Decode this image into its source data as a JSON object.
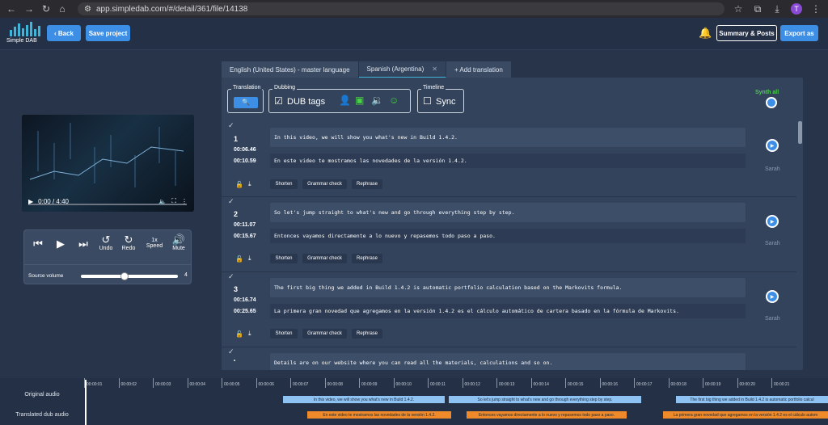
{
  "browser": {
    "url": "app.simpledab.com/#/detail/361/file/14138",
    "avatar_letter": "T"
  },
  "app": {
    "logo_text": "Simple DAB",
    "back": "Back",
    "save": "Save project",
    "summary": "Summary & Posts",
    "export": "Export as"
  },
  "video": {
    "time": "0:00 / 4:40"
  },
  "controls": {
    "undo": "Undo",
    "redo": "Redo",
    "speed_value": "1x",
    "speed": "Speed",
    "mute": "Mute",
    "volume_label": "Source volume",
    "volume_value": "4",
    "volume_fraction": 0.45
  },
  "tabs": [
    {
      "label": "English (United States) - master language"
    },
    {
      "label": "Spanish (Argentina)"
    },
    {
      "label": "+ Add translation"
    }
  ],
  "toolbar": {
    "translation": "Translation",
    "dubbing": "Dubbing",
    "dub_tags": "DUB tags",
    "timeline": "Timeline",
    "sync": "Sync",
    "synth_all": "Synth all"
  },
  "segments": [
    {
      "num": "1",
      "start": "00:06.46",
      "end": "00:10.59",
      "src": "In this video, we will show you what's new in Build 1.4.2.",
      "tgt": "En este video te mostramos las novedades de la versión 1.4.2.",
      "voice": "Sarah"
    },
    {
      "num": "2",
      "start": "00:11.07",
      "end": "00:15.67",
      "src": "So let's jump straight to what's new and go through everything step by step.",
      "tgt": "Entonces vayamos directamente a lo nuevo y repasemos todo paso a paso.",
      "voice": "Sarah"
    },
    {
      "num": "3",
      "start": "00:16.74",
      "end": "00:25.65",
      "src": "The first big thing we added in Build 1.4.2 is automatic portfolio calculation based on the Markovits formula.",
      "tgt": "La primera gran novedad que agregamos en la versión 1.4.2 es el cálculo automático de cartera basado en la fórmula de Markovits.",
      "voice": "Sarah"
    },
    {
      "num": "4",
      "src": "Details are on our website where you can read all the materials, calculations and so on."
    }
  ],
  "segment_actions": {
    "shorten": "Shorten",
    "grammar": "Grammar check",
    "rephrase": "Rephrase"
  },
  "timeline": {
    "original_label": "Original audio",
    "translated_label": "Translated dub audio",
    "ticks": [
      "00:00:01",
      "00:00:02",
      "00:00:03",
      "00:00:04",
      "00:00:05",
      "00:00:06",
      "00:00:07",
      "00:00:08",
      "00:00:09",
      "00:00:10",
      "00:00:11",
      "00:00:12",
      "00:00:13",
      "00:00:14",
      "00:00:15",
      "00:00:16",
      "00:00:17",
      "00:00:18",
      "00:00:19",
      "00:00:20",
      "00:00:21"
    ],
    "original_clips": [
      "In this video, we will show you what's new in Build 1.4.2.",
      "So let's jump straight to what's new and go through everything step by step.",
      "The first big thing we added in Build 1.4.2 is automatic portfolio calcul"
    ],
    "translated_clips": [
      "En este video te mostramos las novedades de la versión 1.4.2.",
      "Entonces vayamos directamente a lo nuevo y repasemos todo paso a paso.",
      "La primera gran novedad que agregamos en la versión 1.4.2 es el cálculo autom"
    ]
  }
}
